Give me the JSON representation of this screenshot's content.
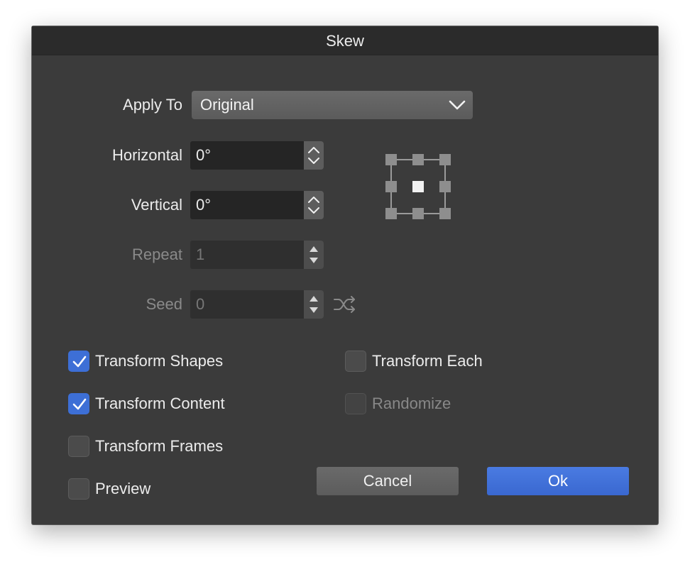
{
  "dialog": {
    "title": "Skew"
  },
  "apply_to": {
    "label": "Apply To",
    "value": "Original"
  },
  "horizontal": {
    "label": "Horizontal",
    "value": "0°"
  },
  "vertical": {
    "label": "Vertical",
    "value": "0°"
  },
  "repeat": {
    "label": "Repeat",
    "value": "1"
  },
  "seed": {
    "label": "Seed",
    "value": "0"
  },
  "options": {
    "transform_shapes": {
      "label": "Transform Shapes",
      "checked": true
    },
    "transform_content": {
      "label": "Transform Content",
      "checked": true
    },
    "transform_frames": {
      "label": "Transform Frames",
      "checked": false
    },
    "preview": {
      "label": "Preview",
      "checked": false
    },
    "transform_each": {
      "label": "Transform Each",
      "checked": false
    },
    "randomize": {
      "label": "Randomize",
      "checked": false,
      "disabled": true
    }
  },
  "buttons": {
    "cancel": "Cancel",
    "ok": "Ok"
  },
  "icons": {
    "dropdown": "chevron-down-icon",
    "stepper": "up-down-stepper-icon",
    "shuffle": "shuffle-icon",
    "anchor": "anchor-point-grid-icon",
    "checkmark": "checkmark-icon"
  },
  "colors": {
    "accent": "#3d6fd6",
    "background": "#3b3b3b",
    "titlebar": "#2b2b2b"
  }
}
